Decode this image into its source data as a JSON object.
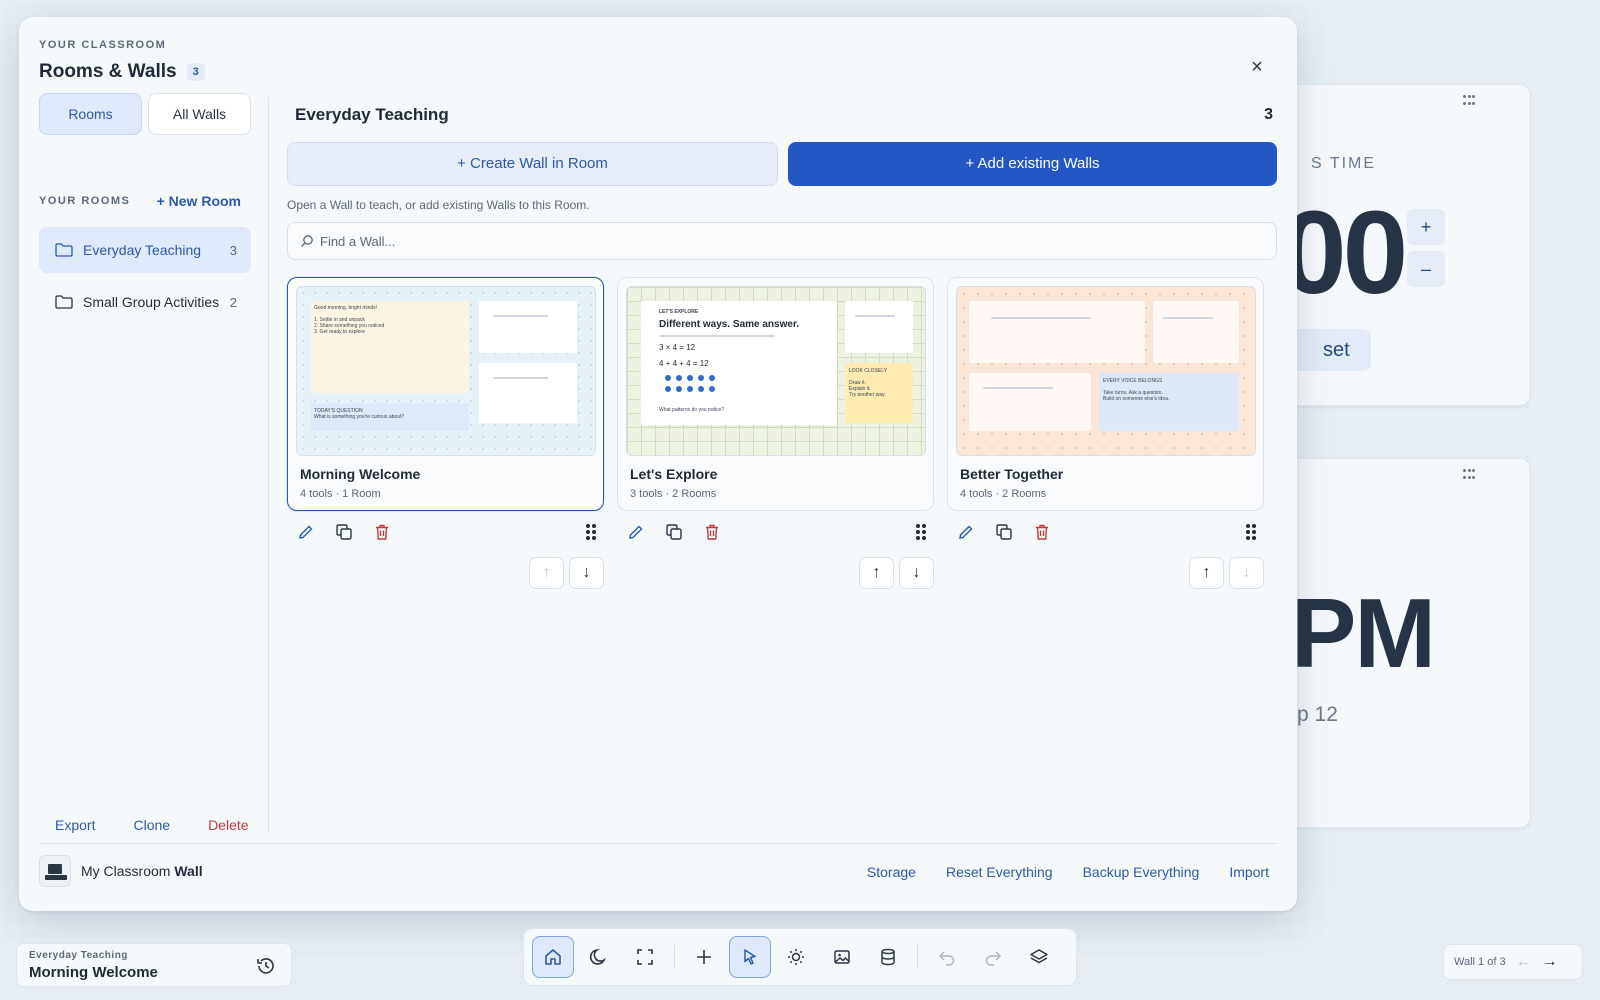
{
  "modal": {
    "eyebrow": "YOUR CLASSROOM",
    "title": "Rooms & Walls",
    "title_count": "3",
    "close_label": "×"
  },
  "sidebar": {
    "tabs": [
      {
        "label": "Rooms",
        "active": true
      },
      {
        "label": "All Walls",
        "active": false
      }
    ],
    "rooms_label": "YOUR ROOMS",
    "new_room_label": "+ New Room",
    "rooms": [
      {
        "name": "Everyday Teaching",
        "count": "3",
        "active": true
      },
      {
        "name": "Small Group Activities",
        "count": "2",
        "active": false
      }
    ],
    "actions": {
      "export": "Export",
      "clone": "Clone",
      "delete": "Delete"
    }
  },
  "main": {
    "title": "Everyday Teaching",
    "count": "3",
    "create_button": "+ Create Wall in Room",
    "add_button": "+ Add existing Walls",
    "hint": "Open a Wall to teach, or add existing Walls to this Room.",
    "search_placeholder": "Find a Wall...",
    "walls": [
      {
        "name": "Morning Welcome",
        "meta": "4 tools · 1 Room",
        "selected": true,
        "thumb": {
          "greeting": "Good morning, bright minds!",
          "steps": [
            "1. Settle in and unpack",
            "2. Share something you noticed",
            "3. Get ready to explore"
          ],
          "question_title": "TODAY'S QUESTION",
          "question": "What is something you're curious about?"
        },
        "up_disabled": true,
        "down_disabled": false
      },
      {
        "name": "Let's Explore",
        "meta": "3 tools · 2 Rooms",
        "selected": false,
        "thumb": {
          "eyebrow": "LET'S EXPLORE",
          "headline": "Different ways. Same answer.",
          "eq1": "3 × 4 = 12",
          "eq2": "4 + 4 + 4 = 12",
          "prompt": "What patterns do you notice?",
          "side_title": "LOOK CLOSELY",
          "side_lines": [
            "Draw it.",
            "Explain it.",
            "Try another way."
          ]
        },
        "up_disabled": false,
        "down_disabled": false
      },
      {
        "name": "Better Together",
        "meta": "4 tools · 2 Rooms",
        "selected": false,
        "thumb": {
          "card_title": "EVERY VOICE BELONGS",
          "card_lines": [
            "Take turns. Ask a question.",
            "Build on someone else's idea."
          ]
        },
        "up_disabled": false,
        "down_disabled": true
      }
    ]
  },
  "footer": {
    "brand_prefix": "My Classroom",
    "brand_bold": "Wall",
    "links": [
      "Storage",
      "Reset Everything",
      "Backup Everything",
      "Import"
    ]
  },
  "now_playing": {
    "room": "Everyday Teaching",
    "wall": "Morning Welcome"
  },
  "dock": {
    "icons": [
      "home-icon",
      "moon-icon",
      "fullscreen-icon",
      "plus-icon",
      "pointer-icon",
      "brightness-icon",
      "image-icon",
      "database-icon",
      "undo-icon",
      "redo-icon",
      "layers-icon"
    ]
  },
  "pager": {
    "label": "Wall 1 of 3",
    "prev": "←",
    "next": "→"
  },
  "background": {
    "timer_label": "S TIME",
    "timer_value": "00",
    "timer_plus": "+",
    "timer_minus": "–",
    "timer_reset": "set",
    "clock_value": "PM",
    "clock_date": "p 12"
  },
  "colors": {
    "accent": "#2358c4",
    "accent_text": "#2b5aa8",
    "danger": "#c23b3b",
    "selected_bg": "#dfe9fb"
  }
}
